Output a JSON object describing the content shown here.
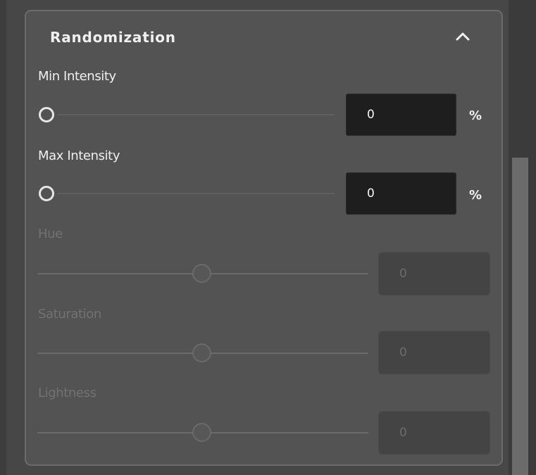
{
  "section": {
    "title": "Randomization",
    "collapse_icon": "chevron-up-icon"
  },
  "controls": {
    "min_intensity": {
      "label": "Min Intensity",
      "value": "0",
      "unit": "%",
      "slider_value": 0
    },
    "max_intensity": {
      "label": "Max Intensity",
      "value": "0",
      "unit": "%",
      "slider_value": 0
    },
    "hue": {
      "label": "Hue",
      "value": "0",
      "disabled": true
    },
    "saturation": {
      "label": "Saturation",
      "value": "0",
      "disabled": true
    },
    "lightness": {
      "label": "Lightness",
      "value": "0",
      "disabled": true
    }
  },
  "colors": {
    "panel_bg": "#535353",
    "panel_border": "#6b6b6b",
    "input_bg": "#1e1e1e",
    "text": "#f0f0f0",
    "disabled_text": "#727272"
  }
}
